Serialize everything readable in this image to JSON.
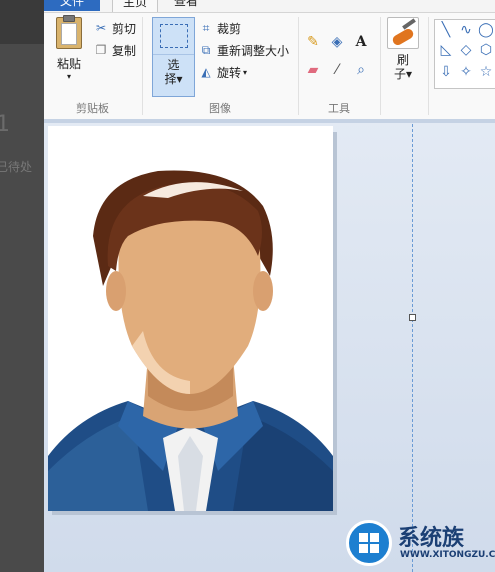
{
  "backdrop": {
    "heading_partial": "1",
    "text_partial": "已待处"
  },
  "tabs": {
    "file": "文件",
    "home": "主页",
    "view": "查看"
  },
  "clipboard": {
    "paste": "粘贴",
    "cut": "剪切",
    "copy": "复制",
    "label": "剪贴板"
  },
  "image": {
    "select_top": "选",
    "select_bottom": "择",
    "crop": "裁剪",
    "resize": "重新调整大小",
    "rotate": "旋转",
    "label": "图像"
  },
  "tools": {
    "label": "工具"
  },
  "brushes": {
    "label_top": "刷",
    "label_bottom": "子"
  },
  "watermark": {
    "title": "系统族",
    "url": "WWW.XITONGZU.COM"
  },
  "colors": {
    "accent": "#2d6bc0",
    "canvas_bg": "#dde6f2",
    "select_active": "#cde1f7"
  }
}
